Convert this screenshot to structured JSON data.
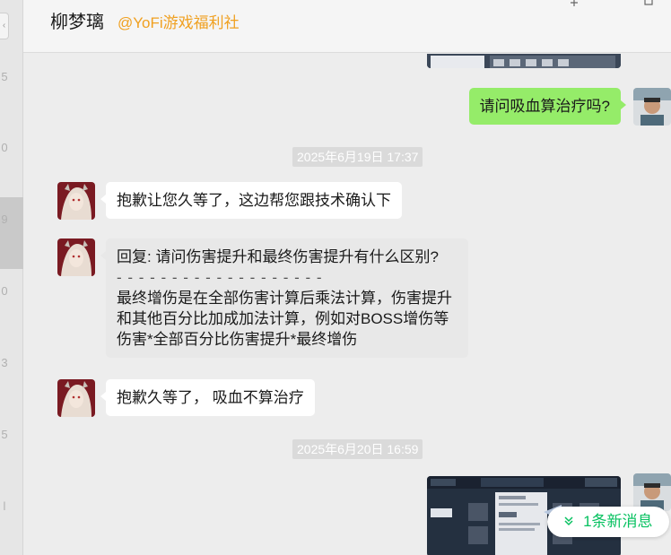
{
  "header": {
    "name": "柳梦璃",
    "tag": "@YoFi游戏福利社"
  },
  "left_strip": {
    "fragments": [
      "5",
      "0",
      "9",
      "0",
      "3",
      "5",
      "l"
    ]
  },
  "messages": {
    "m1": "请问吸血算治疗吗?",
    "ts1": "2025年6月19日 17:37",
    "m2": "抱歉让您久等了，这边帮您跟技术确认下",
    "m3_quote": "回复: 请问伤害提升和最终伤害提升有什么区别?",
    "m3_sep": "- - - - - - - - - - - - - - - - - - -",
    "m3_body": "最终增伤是在全部伤害计算后乘法计算，伤害提升和其他百分比加成加法计算，例如对BOSS增伤等 伤害*全部百分比伤害提升*最终增伤",
    "m4": "抱歉久等了， 吸血不算治疗",
    "ts2": "2025年6月20日 16:59"
  },
  "new_message_pill": {
    "label": "1条新消息",
    "icon": "double-chevron-down-icon"
  },
  "colors": {
    "accent_green": "#07c160",
    "bubble_green": "#95ec69",
    "tag_orange": "#f0a020"
  }
}
